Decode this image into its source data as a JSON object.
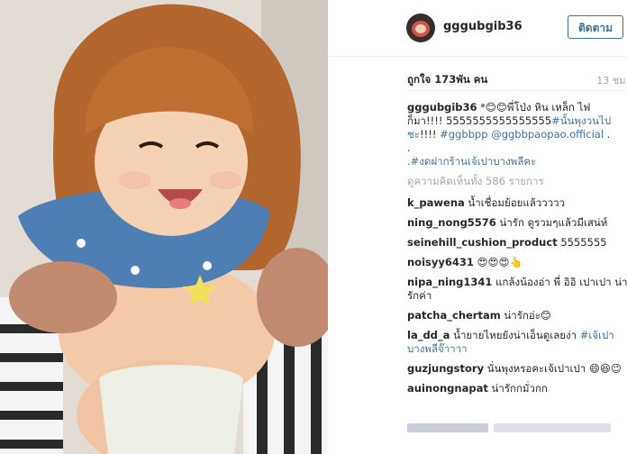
{
  "post": {
    "username": "gggubgib36",
    "follow_label": "ติดตาม",
    "likes": "ถูกใจ 173พัน คน",
    "time": "13 ชม."
  },
  "caption": {
    "user": "gggubgib36",
    "text": " *😊😊พี่โป่ง หิน เหล็ก ไฟ ก็มา!!!! 5555555555555555",
    "tag1": "#นั้นพุงวนไปชะ",
    "text2": "!!!! ",
    "tag2": "#ggbbpp",
    "mention": "@ggbbpaopao.official",
    "text3": " .",
    "dot": ".",
    "tag3": ".#งดฝากร้านเจ้เปาบางพลีคะ"
  },
  "view_all": "ดูความคิดเห็นทั้ง 586 รายการ",
  "comments": [
    {
      "user": "k_pawena",
      "text": " น้ำเชื่อมย้อยแล้ววววว"
    },
    {
      "user": "ning_nong5576",
      "text": " น่ารัก ดูรวมๆแล้วมีเสน่ห์"
    },
    {
      "user": "seinehill_cushion_product",
      "text": " 5555555"
    },
    {
      "user": "noisyy6431",
      "text": " 😍😍😍👆"
    },
    {
      "user": "nipa_ning1341",
      "text": " แกล้งน้องอ่า พี่ อิอิ เปาเปา น่ารักค่า"
    },
    {
      "user": "patcha_chertam",
      "text": " น่ารักอ่ะ😊"
    },
    {
      "user": "la_dd_a",
      "text": " น้ำยายไหยยังน่าเอ็นดูเลยง่า ",
      "tag": "#เจ้เปาบางพลีจ๊าาาา"
    },
    {
      "user": "guzjungstory",
      "text": " นั่นพุงหรอคะเจ้เปาเปา 😄😆😉"
    },
    {
      "user": "auinongnapat",
      "text": " น่ารักกมั่วกก"
    }
  ],
  "colors": {
    "link": "#3f729b",
    "muted": "#a5a7aa",
    "text": "#262626"
  }
}
